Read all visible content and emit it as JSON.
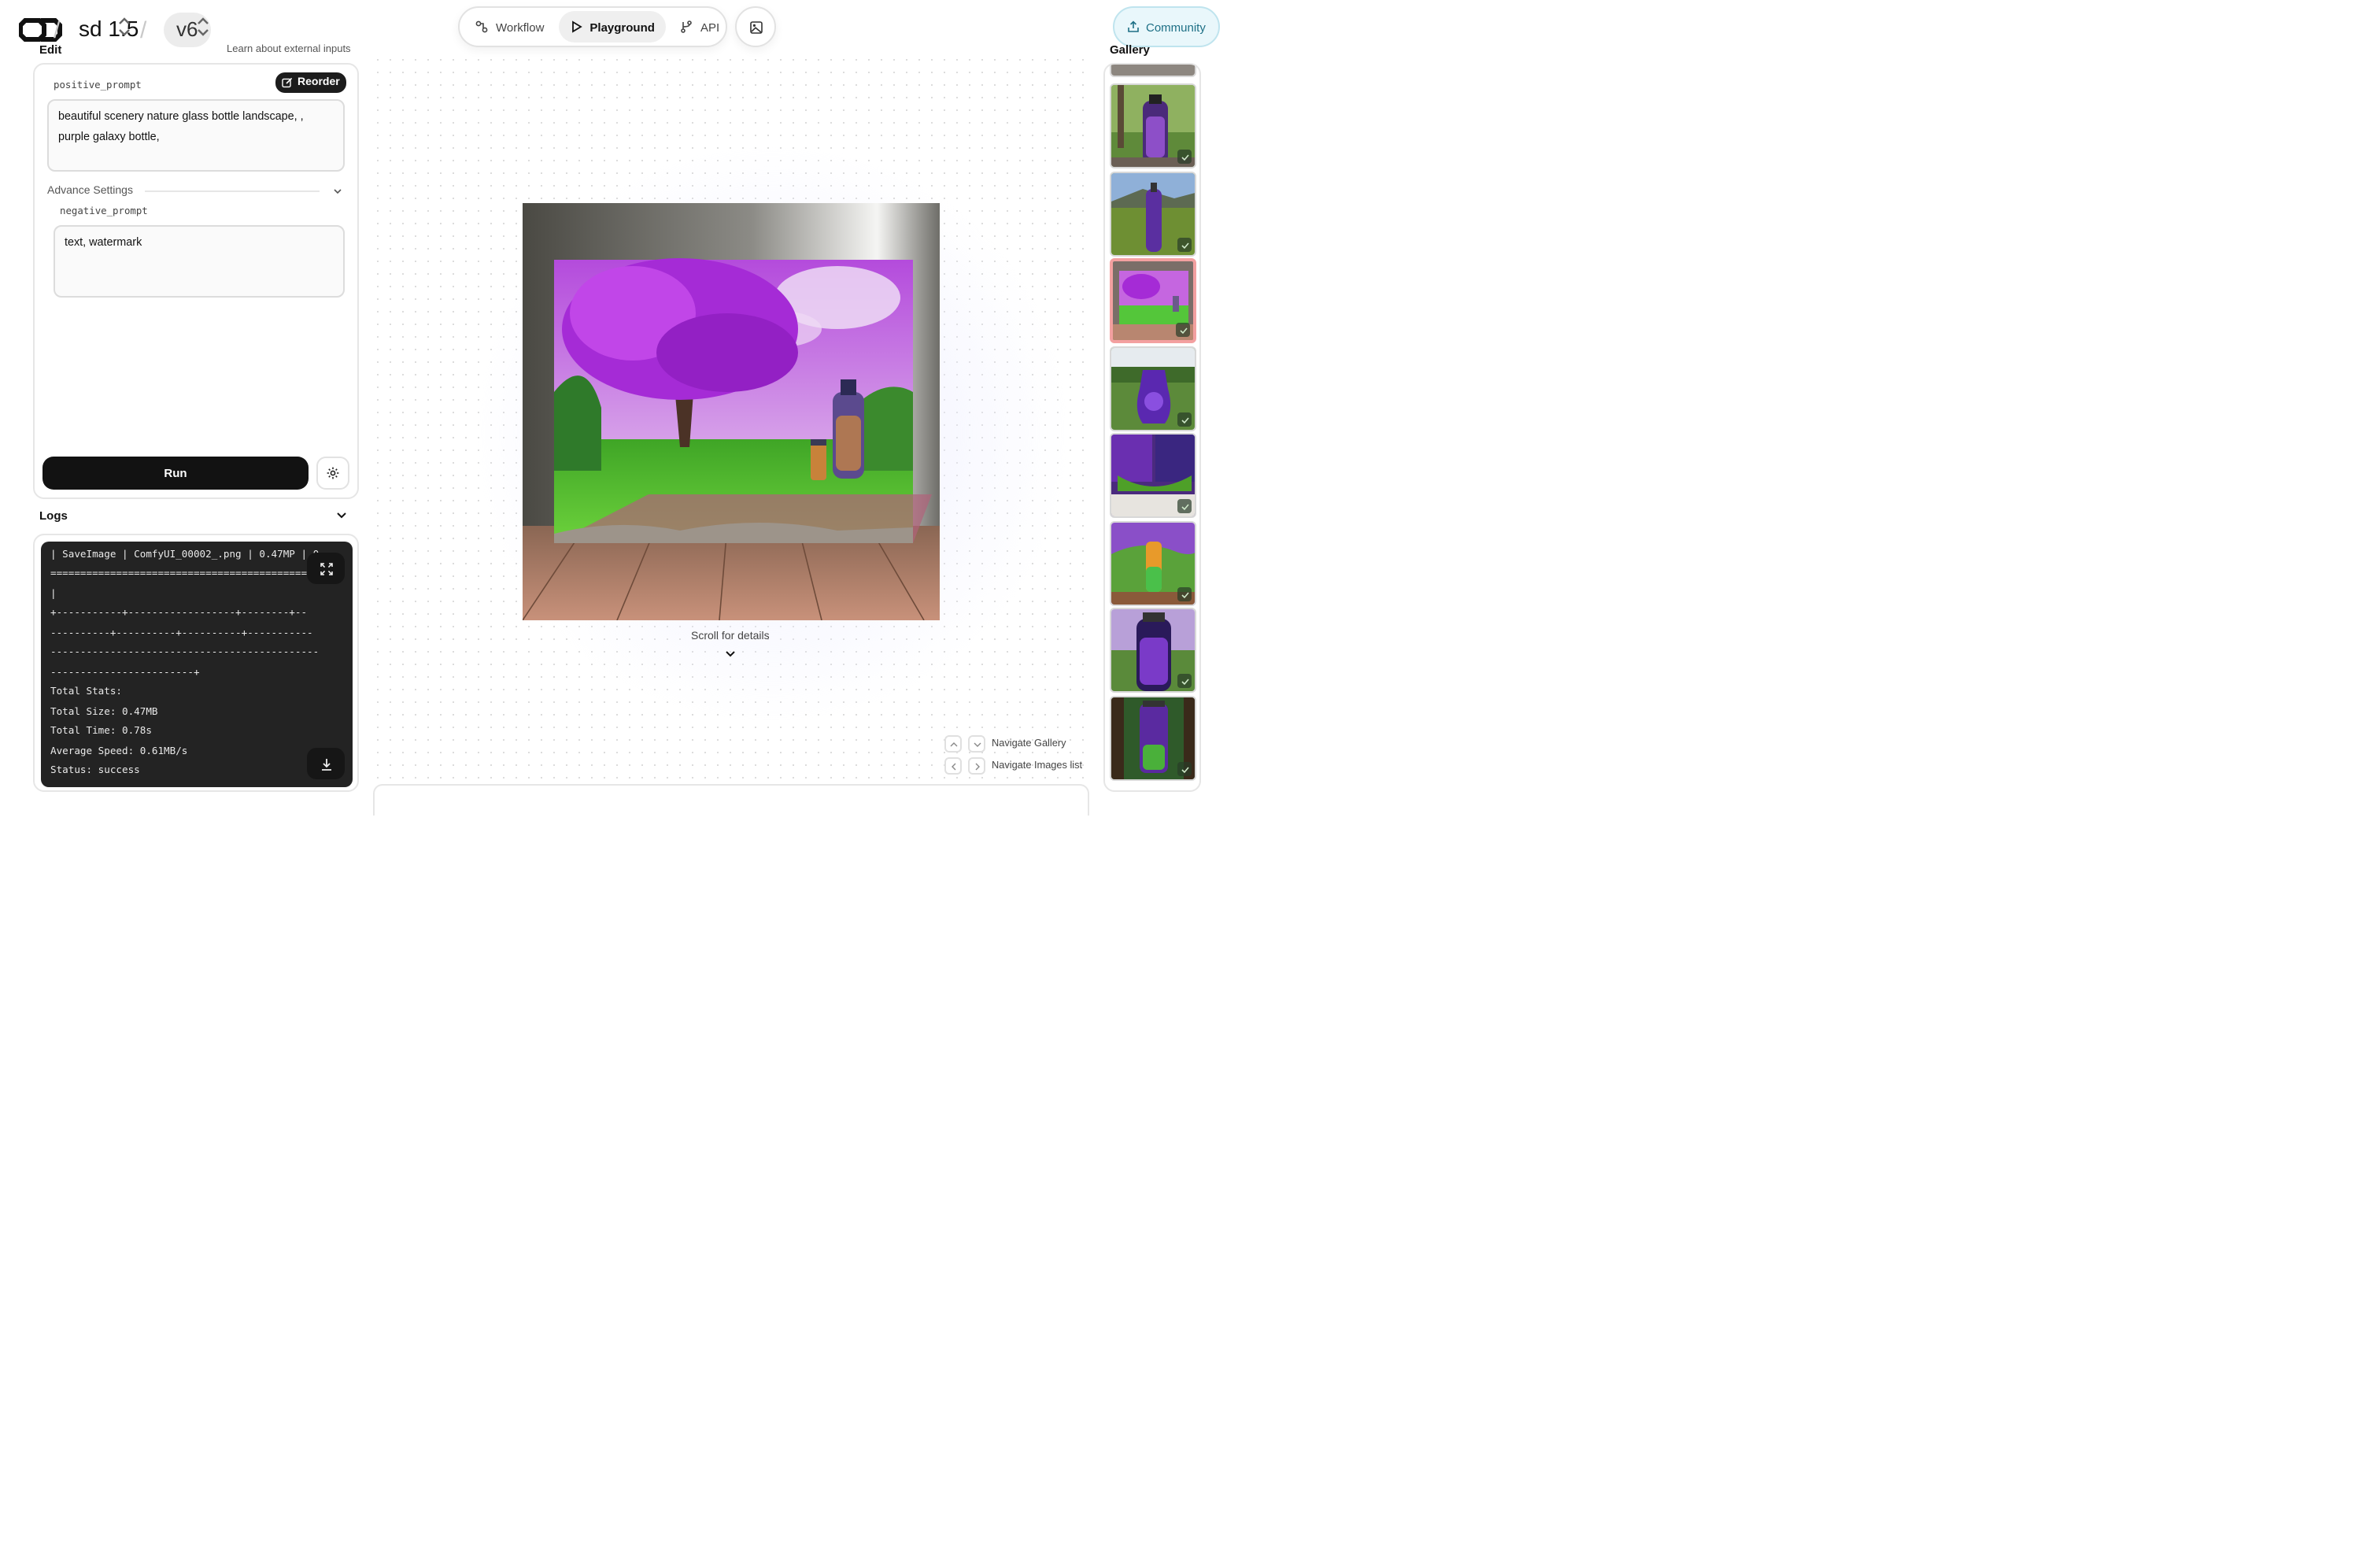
{
  "header": {
    "project": "sd 1.5",
    "version": "v6",
    "tabs": [
      {
        "label": "Workflow",
        "icon": "workflow-icon"
      },
      {
        "label": "Playground",
        "icon": "play-icon"
      },
      {
        "label": "API",
        "icon": "api-icon"
      }
    ],
    "active_tab": "Playground",
    "community_label": "Community"
  },
  "edit": {
    "title": "Edit",
    "learn_link": "Learn about external inputs",
    "positive_label": "positive_prompt",
    "reorder_label": "Reorder",
    "positive_value": "beautiful scenery nature glass bottle landscape, ,\npurple galaxy bottle,",
    "advance_label": "Advance Settings",
    "negative_label": "negative_prompt",
    "negative_value": "text, watermark",
    "run_label": "Run"
  },
  "logs": {
    "title": "Logs",
    "lines": [
      "| SaveImage | ComfyUI_00002_.png | 0.47MP | 0.",
      "=============================================",
      "|",
      "+-----------+------------------+--------+--",
      "----------+----------+----------+-----------",
      "---------------------------------------------",
      "------------------------+",
      "Total Stats:",
      "Total Size: 0.47MB",
      "Total Time: 0.78s",
      "Average Speed: 0.61MB/s",
      "Status: success"
    ]
  },
  "center": {
    "scroll_hint": "Scroll for details",
    "nav_gallery": "Navigate Gallery",
    "nav_images": "Navigate Images list"
  },
  "gallery": {
    "title": "Gallery",
    "selected_index": 2,
    "thumbs": [
      {
        "desc": "galaxy bottle on log"
      },
      {
        "desc": "purple bottle in field"
      },
      {
        "desc": "framed tree with bottle"
      },
      {
        "desc": "purple vase on grass"
      },
      {
        "desc": "split purple landscape"
      },
      {
        "desc": "rainbow bottle on hills"
      },
      {
        "desc": "galaxy bottle in park"
      },
      {
        "desc": "galaxy jar in forest"
      }
    ]
  },
  "colors": {
    "accent_dark": "#121212",
    "community_bg": "#e9f7fb",
    "community_text": "#1d6f85",
    "selected_border": "#f3a0a0",
    "purple": "#a530d6"
  }
}
